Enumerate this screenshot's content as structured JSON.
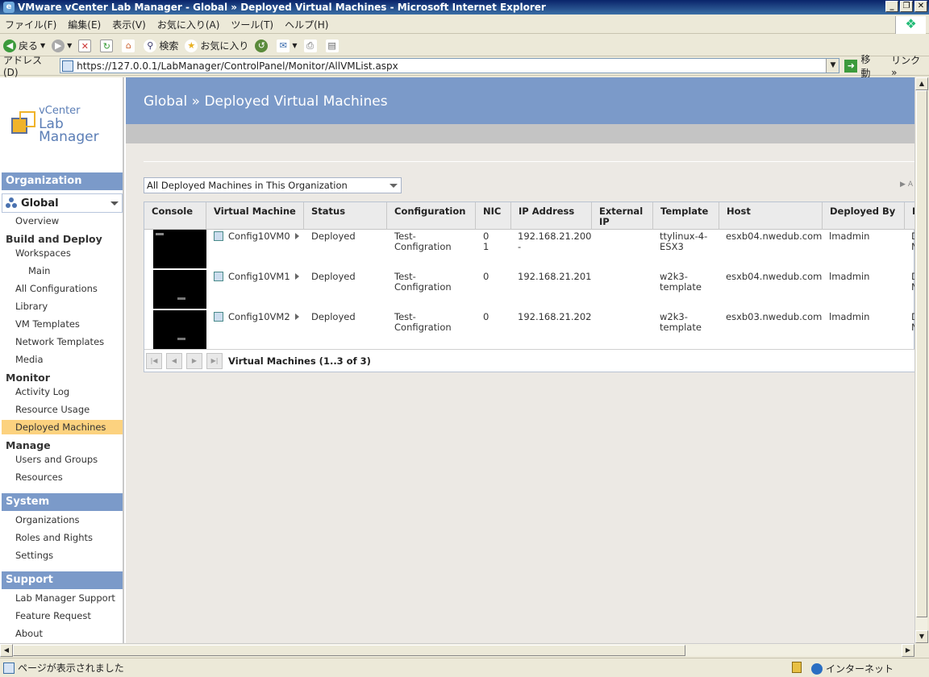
{
  "window": {
    "title": "VMware vCenter Lab Manager - Global » Deployed Virtual Machines - Microsoft Internet Explorer"
  },
  "menu": [
    "ファイル(F)",
    "編集(E)",
    "表示(V)",
    "お気に入り(A)",
    "ツール(T)",
    "ヘルプ(H)"
  ],
  "toolbar": {
    "back": "戻る",
    "search": "検索",
    "favorites": "お気に入り"
  },
  "address": {
    "label": "アドレス(D)",
    "url": "https://127.0.0.1/LabManager/ControlPanel/Monitor/AllVMList.aspx",
    "go": "移動",
    "links": "リンク"
  },
  "logo": {
    "line1": "vCenter",
    "line2": "Lab Manager"
  },
  "sidebar": {
    "organization_head": "Organization",
    "org_selected": "Global",
    "overview": "Overview",
    "build_deploy": "Build and Deploy",
    "workspaces": "Workspaces",
    "main": "Main",
    "all_configurations": "All Configurations",
    "library": "Library",
    "vm_templates": "VM Templates",
    "network_templates": "Network Templates",
    "media": "Media",
    "monitor": "Monitor",
    "activity_log": "Activity Log",
    "resource_usage": "Resource Usage",
    "deployed_machines": "Deployed Machines",
    "manage": "Manage",
    "users_groups": "Users and Groups",
    "resources": "Resources",
    "system_head": "System",
    "organizations": "Organizations",
    "roles_rights": "Roles and Rights",
    "settings": "Settings",
    "support_head": "Support",
    "lm_support": "Lab Manager Support",
    "feature_request": "Feature Request",
    "about": "About"
  },
  "page": {
    "title": "Global » Deployed Virtual Machines",
    "filter": "All Deployed Machines in This Organization"
  },
  "grid": {
    "headers": {
      "console": "Console",
      "vm": "Virtual Machine",
      "status": "Status",
      "configuration": "Configuration",
      "nic": "NIC",
      "ip": "IP Address",
      "external_ip": "External IP",
      "template": "Template",
      "host": "Host",
      "deployed_by": "Deployed By"
    },
    "rows": [
      {
        "vm": "Config10VM0",
        "status": "Deployed",
        "configuration": "Test-Configration",
        "nic": "0\n1",
        "ip": "192.168.21.200\n-",
        "external_ip": "",
        "template": "ttylinux-4-ESX3",
        "host": "esxb04.nwedub.com",
        "deployed_by": "lmadmin",
        "extra": "D\nN"
      },
      {
        "vm": "Config10VM1",
        "status": "Deployed",
        "configuration": "Test-Configration",
        "nic": "0",
        "ip": "192.168.21.201",
        "external_ip": "",
        "template": "w2k3-template",
        "host": "esxb04.nwedub.com",
        "deployed_by": "lmadmin",
        "extra": "D\nN"
      },
      {
        "vm": "Config10VM2",
        "status": "Deployed",
        "configuration": "Test-Configration",
        "nic": "0",
        "ip": "192.168.21.202",
        "external_ip": "",
        "template": "w2k3-template",
        "host": "esxb03.nwedub.com",
        "deployed_by": "lmadmin",
        "extra": "D\nN"
      }
    ],
    "pager": "Virtual Machines (1..3 of 3)"
  },
  "status": {
    "text": "ページが表示されました",
    "zone": "インターネット"
  }
}
